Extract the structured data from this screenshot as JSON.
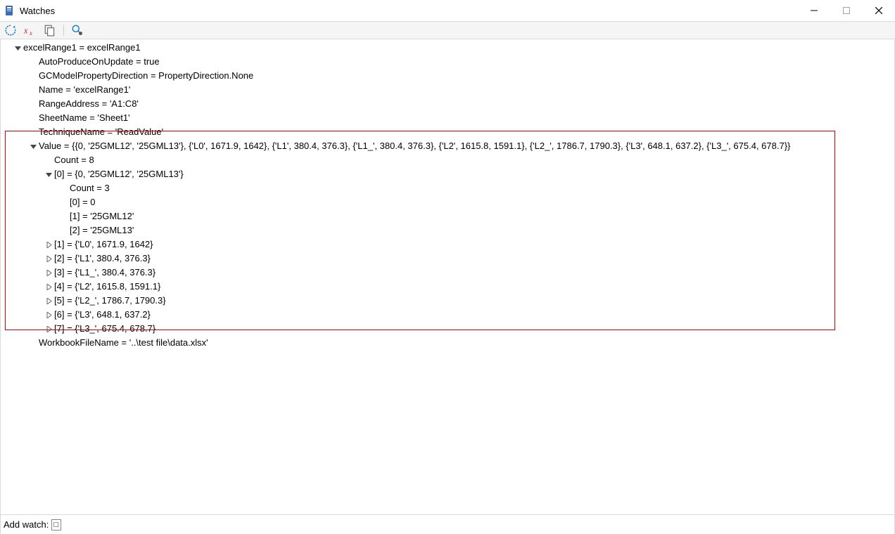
{
  "window": {
    "title": "Watches"
  },
  "footer": {
    "label": "Add watch:",
    "value": "□"
  },
  "tree": {
    "root": {
      "label": "excelRange1 = excelRange1",
      "props": {
        "auto": "AutoProduceOnUpdate = true",
        "gcm": "GCModelPropertyDirection = PropertyDirection.None",
        "name": "Name = 'excelRange1'",
        "range": "RangeAddress = 'A1:C8'",
        "sheet": "SheetName = 'Sheet1'",
        "tech": "TechniqueName = 'ReadValue'",
        "workbook": "WorkbookFileName = '..\\test file\\data.xlsx'"
      },
      "value": {
        "label": "Value = {{0, '25GML12', '25GML13'}, {'L0', 1671.9, 1642}, {'L1', 380.4, 376.3}, {'L1_', 380.4, 376.3}, {'L2', 1615.8, 1591.1}, {'L2_', 1786.7, 1790.3}, {'L3', 648.1, 637.2}, {'L3_', 675.4, 678.7}}",
        "count": "Count = 8",
        "items": [
          {
            "label": "[0] = {0, '25GML12', '25GML13'}",
            "expanded": true,
            "count": "Count = 3",
            "sub": [
              "[0] = 0",
              "[1] = '25GML12'",
              "[2] = '25GML13'"
            ]
          },
          {
            "label": "[1] = {'L0', 1671.9, 1642}"
          },
          {
            "label": "[2] = {'L1', 380.4, 376.3}"
          },
          {
            "label": "[3] = {'L1_', 380.4, 376.3}"
          },
          {
            "label": "[4] = {'L2', 1615.8, 1591.1}"
          },
          {
            "label": "[5] = {'L2_', 1786.7, 1790.3}"
          },
          {
            "label": "[6] = {'L3', 648.1, 637.2}"
          },
          {
            "label": "[7] = {'L3_', 675.4, 678.7}"
          }
        ]
      }
    }
  }
}
